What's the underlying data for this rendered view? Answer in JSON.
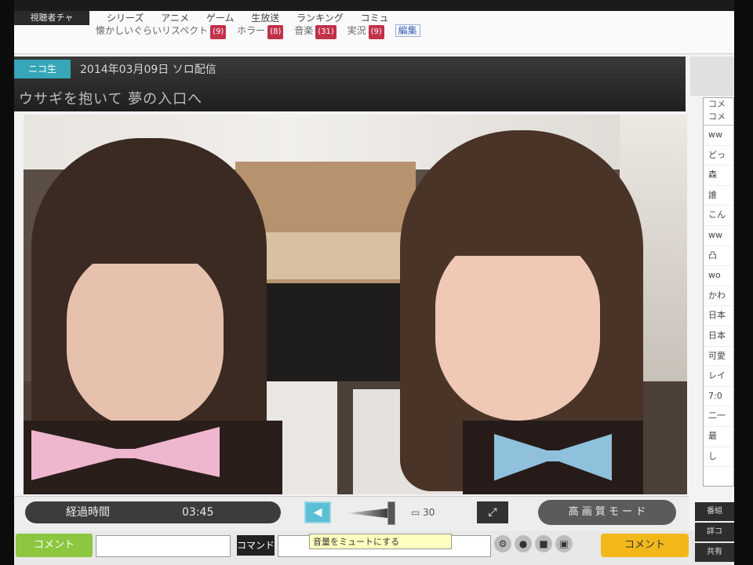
{
  "header": {
    "tab_left": "視聴者チャ",
    "menu_items": [
      "シリーズ",
      "アニメ",
      "ゲーム",
      "生放送",
      "ランキング",
      "コミュ"
    ],
    "tags": [
      {
        "label": "懐かしいぐらいリスペクト",
        "count": "(9)"
      },
      {
        "label": "ホラー",
        "count": "(8)"
      },
      {
        "label": "音楽",
        "count": "(31)"
      },
      {
        "label": "実況",
        "count": "(9)"
      }
    ],
    "edit_label": "編集"
  },
  "broadcast": {
    "badge": "ニコ生",
    "date": "2014年03月09日 ソロ配信",
    "subtitle": "ウサギを抱いて 夢の入口へ"
  },
  "comment_panel": {
    "header": "コメ コメ",
    "rows": [
      "ww",
      "どっ",
      "森",
      "誰",
      "こん",
      "ww",
      "凸",
      "wo",
      "かわ",
      "日本",
      "日本",
      "可愛",
      "レイ",
      "7:0",
      "二一",
      "最",
      "し"
    ]
  },
  "controls": {
    "elapsed_label": "経過時間",
    "elapsed_time": "03:45",
    "comment_count": "30",
    "pill_button": "高 画 質 モ ー ド",
    "tooltip": "音量をミュートにする"
  },
  "bottom_bar": {
    "comment_button": "コメント",
    "color_button": "コマンド",
    "input_placeholder": "",
    "send_button": "コメント"
  },
  "right_buttons": [
    "番組",
    "詳コ",
    "共有"
  ],
  "colors": {
    "accent_teal": "#36a6b8",
    "send_yellow": "#f2b81a",
    "comment_green": "#8dc63f",
    "tag_red": "#c2314a"
  }
}
